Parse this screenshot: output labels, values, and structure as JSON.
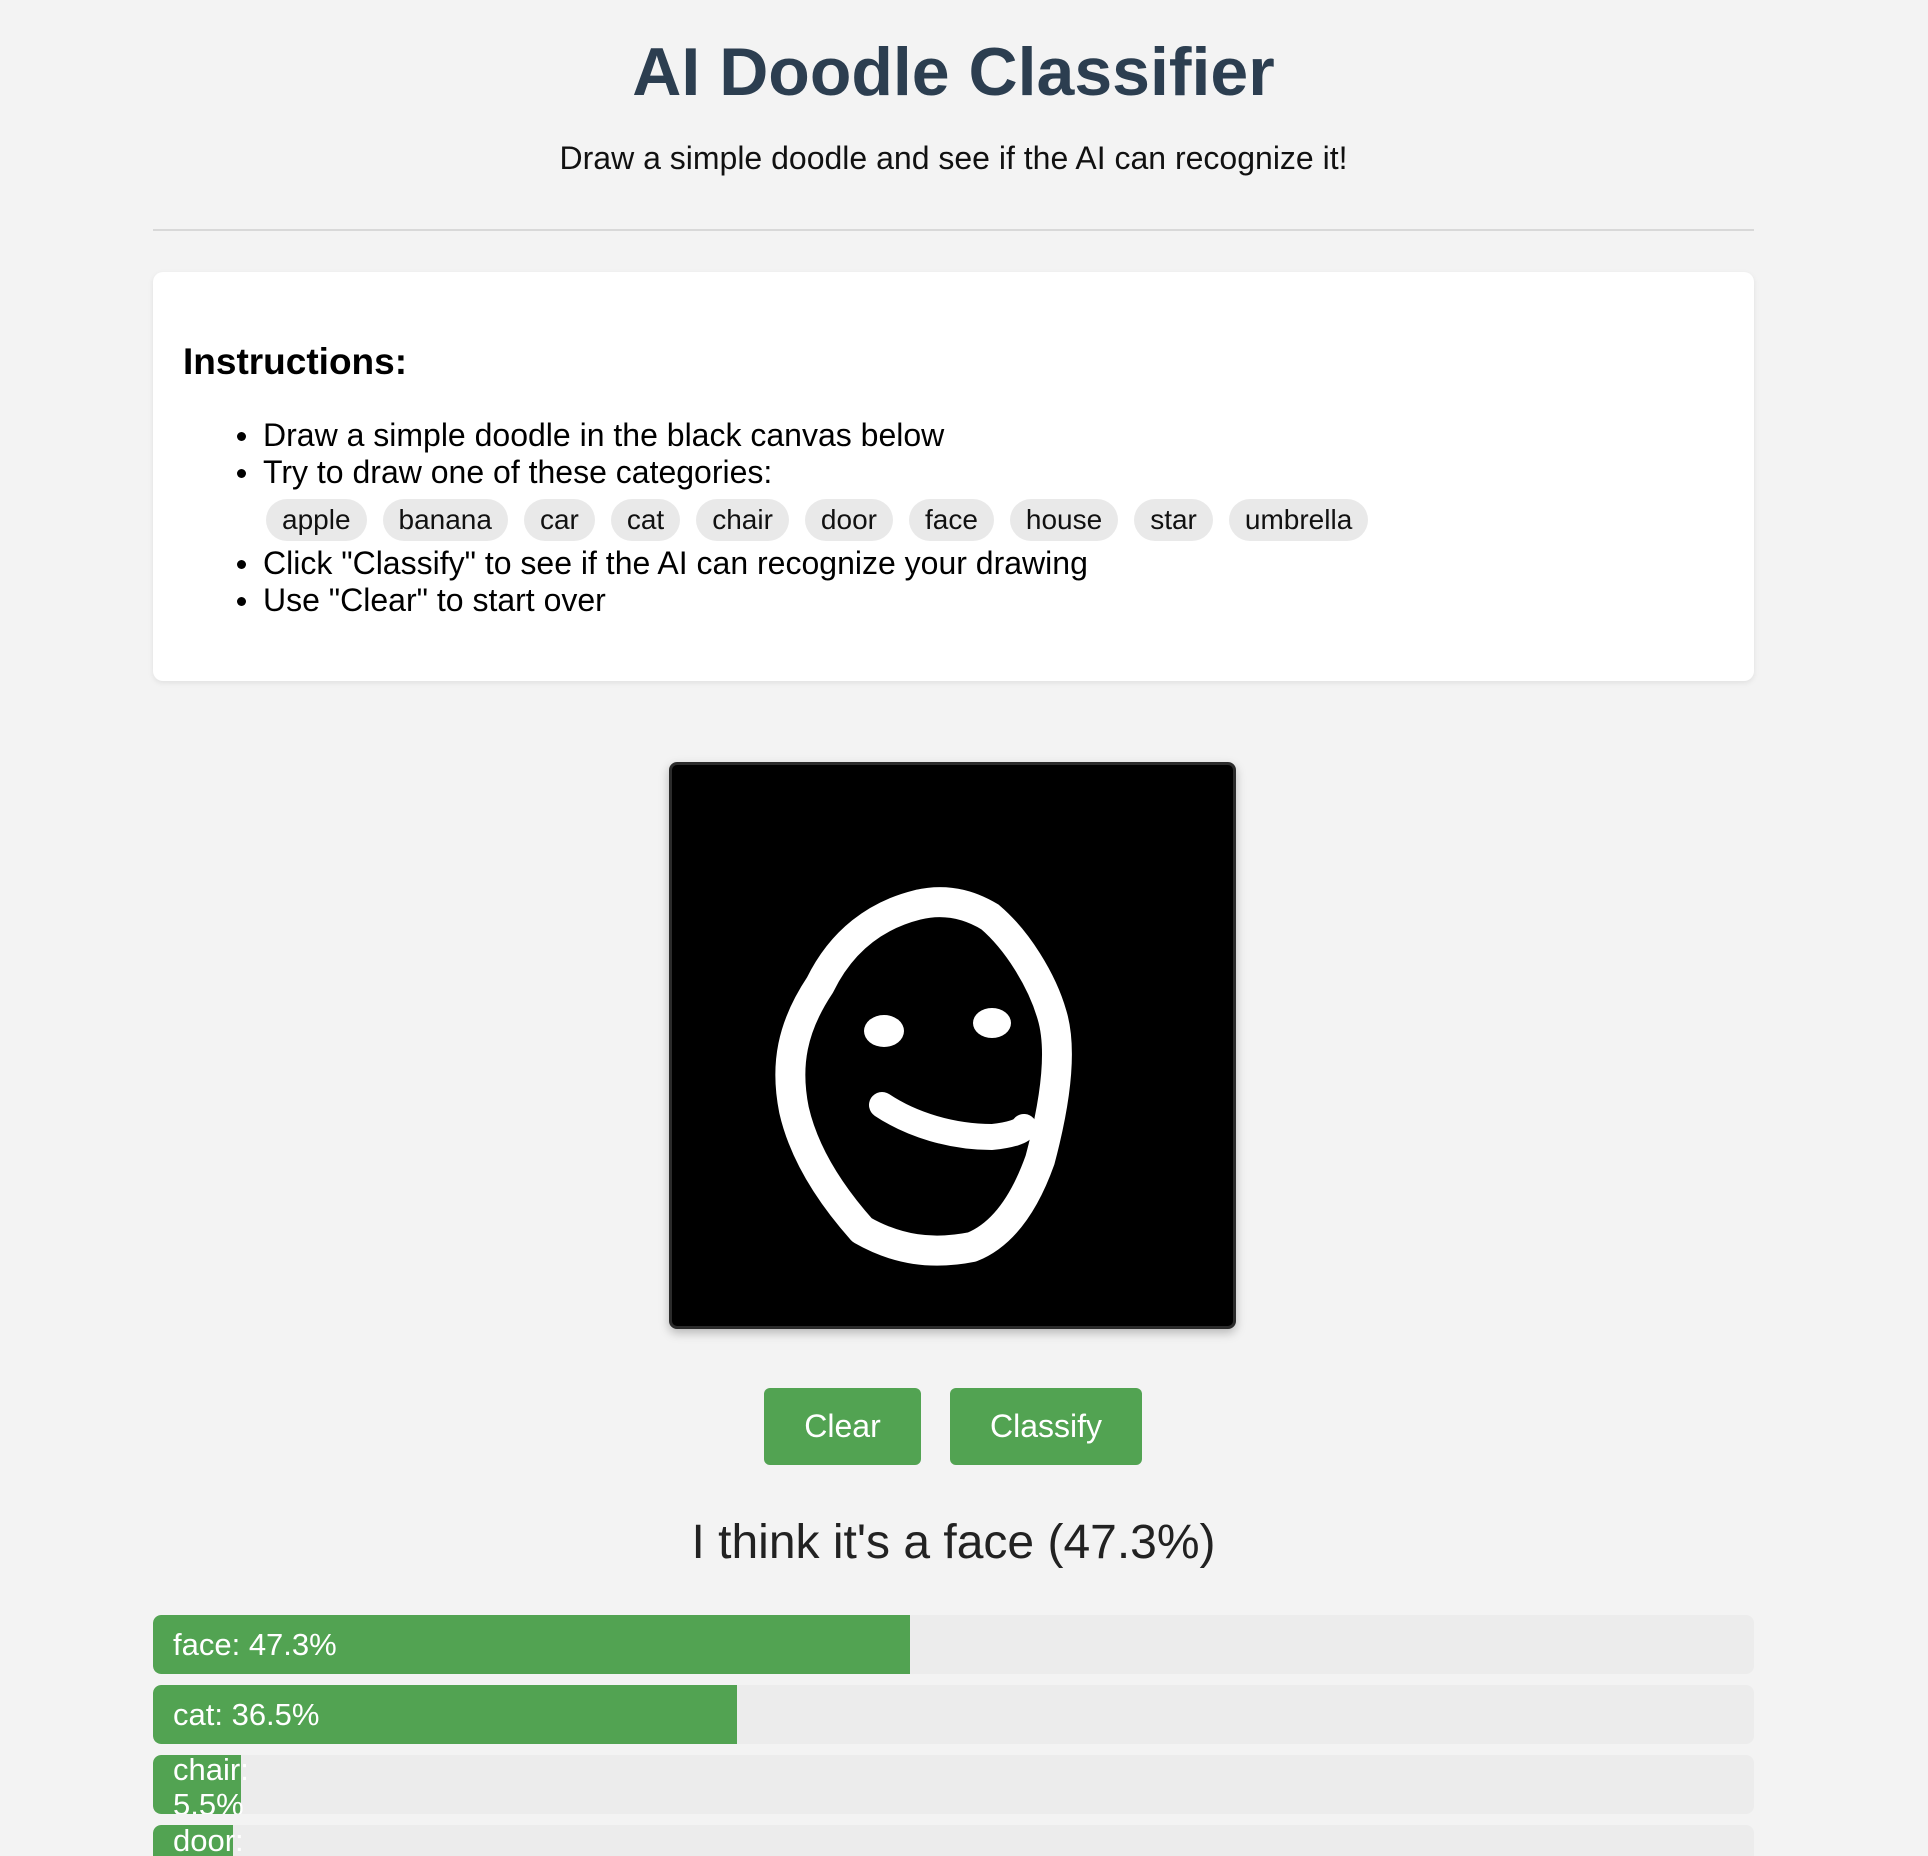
{
  "header": {
    "title": "AI Doodle Classifier",
    "subtitle": "Draw a simple doodle and see if the AI can recognize it!"
  },
  "instructions": {
    "heading": "Instructions:",
    "items": [
      "Draw a simple doodle in the black canvas below",
      "Try to draw one of these categories:",
      "Click \"Classify\" to see if the AI can recognize your drawing",
      "Use \"Clear\" to start over"
    ],
    "categories": [
      "apple",
      "banana",
      "car",
      "cat",
      "chair",
      "door",
      "face",
      "house",
      "star",
      "umbrella"
    ]
  },
  "buttons": {
    "clear_label": "Clear",
    "classify_label": "Classify"
  },
  "result": {
    "message": "I think it's a face (47.3%)"
  },
  "predictions": [
    {
      "label": "face: 47.3%",
      "value": 47.3
    },
    {
      "label": "cat: 36.5%",
      "value": 36.5
    },
    {
      "label": "chair: 5.5%",
      "value": 5.5
    },
    {
      "label": "door:",
      "value": 5.0
    }
  ],
  "colors": {
    "title": "#2c3e50",
    "accent": "#52a352",
    "canvas": "#000000",
    "stroke": "#ffffff"
  }
}
